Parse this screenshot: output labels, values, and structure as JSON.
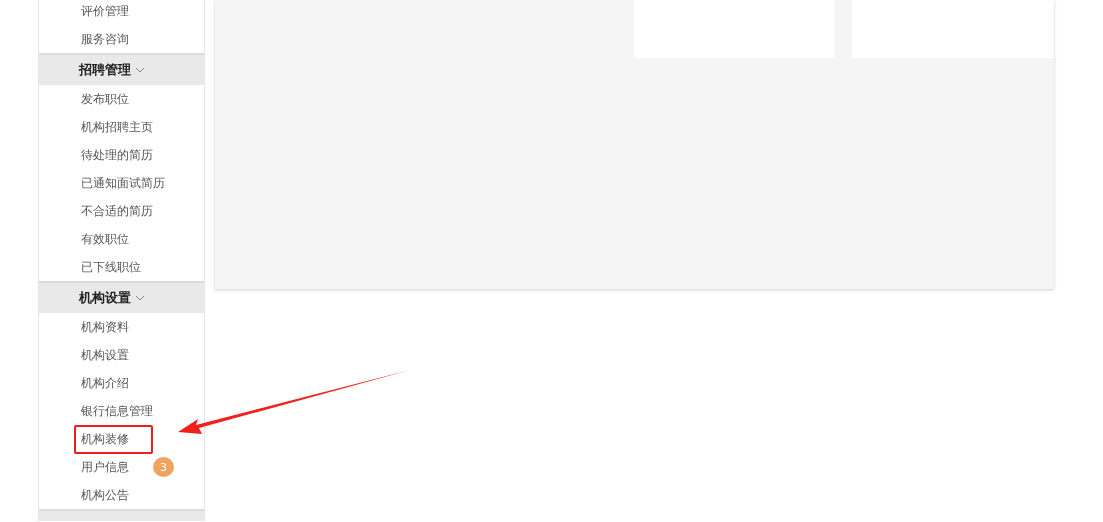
{
  "sidebar": {
    "top_items": [
      {
        "label": "评价管理",
        "highlighted": false
      },
      {
        "label": "服务咨询",
        "highlighted": false
      }
    ],
    "groups": [
      {
        "title": "招聘管理",
        "expanded": true,
        "items": [
          {
            "label": "发布职位",
            "highlighted": false
          },
          {
            "label": "机构招聘主页",
            "highlighted": false
          },
          {
            "label": "待处理的简历",
            "highlighted": false
          },
          {
            "label": "已通知面试简历",
            "highlighted": false
          },
          {
            "label": "不合适的简历",
            "highlighted": false
          },
          {
            "label": "有效职位",
            "highlighted": false
          },
          {
            "label": "已下线职位",
            "highlighted": false
          }
        ]
      },
      {
        "title": "机构设置",
        "expanded": true,
        "items": [
          {
            "label": "机构资料",
            "highlighted": false
          },
          {
            "label": "机构设置",
            "highlighted": false
          },
          {
            "label": "机构介绍",
            "highlighted": false
          },
          {
            "label": "银行信息管理",
            "highlighted": false
          },
          {
            "label": "机构装修",
            "highlighted": true
          },
          {
            "label": "用户信息",
            "highlighted": false,
            "badge": "3"
          },
          {
            "label": "机构公告",
            "highlighted": false
          }
        ]
      }
    ]
  },
  "annotation": {
    "arrow": true
  }
}
